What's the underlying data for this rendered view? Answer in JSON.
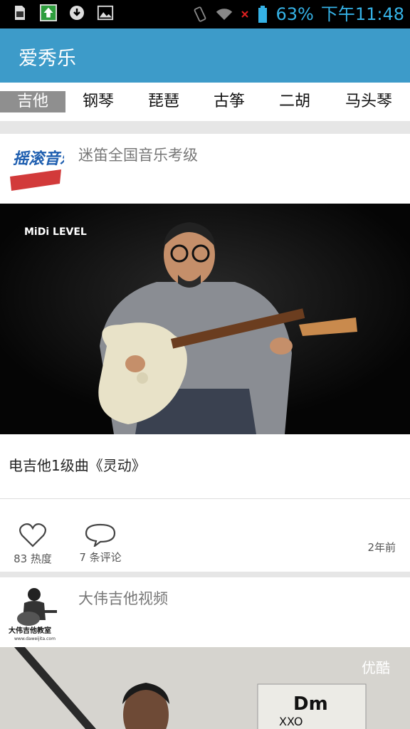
{
  "status_bar": {
    "battery": "63%",
    "time": "下午11:48",
    "icons": [
      "sd-card-icon",
      "upload-arrow-icon",
      "download-circle-icon",
      "image-icon",
      "vibrate-icon",
      "wifi-icon",
      "no-signal-x-icon",
      "battery-icon"
    ]
  },
  "app": {
    "title": "爱秀乐",
    "accent_color": "#3d9bc9"
  },
  "tabs": [
    {
      "label": "吉他",
      "active": true
    },
    {
      "label": "钢琴",
      "active": false
    },
    {
      "label": "琵琶",
      "active": false
    },
    {
      "label": "古筝",
      "active": false
    },
    {
      "label": "二胡",
      "active": false
    },
    {
      "label": "马头琴",
      "active": false
    }
  ],
  "feed": [
    {
      "source": "迷笛全国音乐考级",
      "source_logo_text": "摇滚音乐课",
      "video_watermark": "MiDi LEVEL",
      "title": "电吉他1级曲《灵动》",
      "likes": "83 热度",
      "comments": "7 条评论",
      "time": "2年前"
    },
    {
      "source": "大伟吉他视频",
      "source_logo_text": "大伟吉他教室",
      "source_logo_url_text": "www.daweijita.com",
      "video_watermark": "优酷",
      "chord_label": "Dm",
      "chord_marks": "XXO"
    }
  ]
}
